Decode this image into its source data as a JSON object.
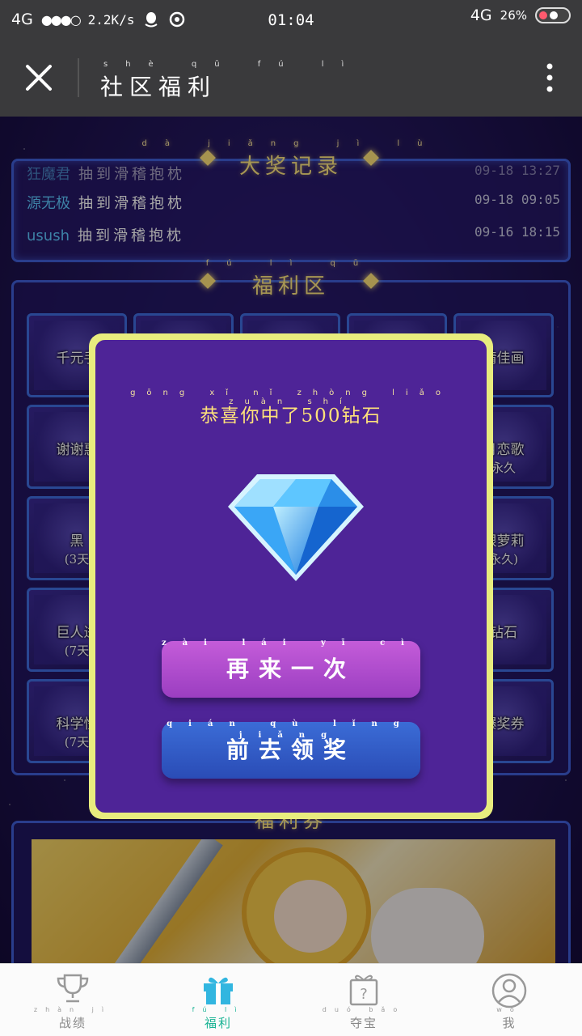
{
  "status_bar": {
    "network_left": "4G",
    "signal": "●●●○",
    "speed": "2.2K/s",
    "time": "01:04",
    "network_right": "4G",
    "battery": "26%"
  },
  "title_bar": {
    "title": "社区福利",
    "pinyin": "shè qū fú lì"
  },
  "records": {
    "title": "大奖记录",
    "title_pinyin": "dà jiǎng jì lù",
    "rows": [
      {
        "user": "狂魔君",
        "text": "抽到滑稽抱枕",
        "date": "09-18 13:27"
      },
      {
        "user": "源无极",
        "text": "抽到滑稽抱枕",
        "date": "09-18 09:05"
      },
      {
        "user": "usush",
        "text": "抽到滑稽抱枕",
        "date": "09-16 18:15"
      }
    ]
  },
  "welfare": {
    "title": "福利区",
    "title_pinyin": "fú lì qū",
    "tiles": [
      {
        "label": "千元手",
        "sub": ""
      },
      {
        "label": "",
        "sub": ""
      },
      {
        "label": "",
        "sub": ""
      },
      {
        "label": "",
        "sub": ""
      },
      {
        "label": "精佳画",
        "sub": ""
      },
      {
        "label": "谢谢惠",
        "sub": ""
      },
      {
        "label": "",
        "sub": ""
      },
      {
        "label": "",
        "sub": ""
      },
      {
        "label": "",
        "sub": ""
      },
      {
        "label": "月恋歌",
        "sub": "永久"
      },
      {
        "label": "黑",
        "sub": "(3天"
      },
      {
        "label": "",
        "sub": ""
      },
      {
        "label": "",
        "sub": ""
      },
      {
        "label": "",
        "sub": ""
      },
      {
        "label": "银萝莉",
        "sub": "永久)"
      },
      {
        "label": "巨人进",
        "sub": "(7天"
      },
      {
        "label": "",
        "sub": ""
      },
      {
        "label": "",
        "sub": ""
      },
      {
        "label": "",
        "sub": ""
      },
      {
        "label": "钻石",
        "sub": ""
      },
      {
        "label": "科学怪",
        "sub": "(7天"
      },
      {
        "label": "",
        "sub": ""
      },
      {
        "label": "",
        "sub": ""
      },
      {
        "label": "",
        "sub": ""
      },
      {
        "label": "爆奖券",
        "sub": ""
      }
    ]
  },
  "lower": {
    "title": "福利券"
  },
  "modal": {
    "title": "恭喜你中了500钻石",
    "title_pinyin": "gōng xǐ nǐ zhòng liǎo zuàn shí",
    "retry_label": "再来一次",
    "retry_pinyin": "zài lái yī cì",
    "claim_label": "前去领奖",
    "claim_pinyin": "qián qù lǐng jiǎng"
  },
  "bottom_nav": [
    {
      "label": "战绩",
      "pinyin": "zhàn jì",
      "icon": "trophy-icon"
    },
    {
      "label": "福利",
      "pinyin": "fú lì",
      "icon": "gift-icon"
    },
    {
      "label": "夺宝",
      "pinyin": "duó bǎo",
      "icon": "mystery-box-icon"
    },
    {
      "label": "我",
      "pinyin": "wǒ",
      "icon": "user-icon"
    }
  ],
  "colors": {
    "accent": "#1ab394",
    "modal_border": "#e8ec7e",
    "modal_bg": "#4e2497",
    "retry_button": "#b14ecd",
    "claim_button": "#3060cc"
  }
}
